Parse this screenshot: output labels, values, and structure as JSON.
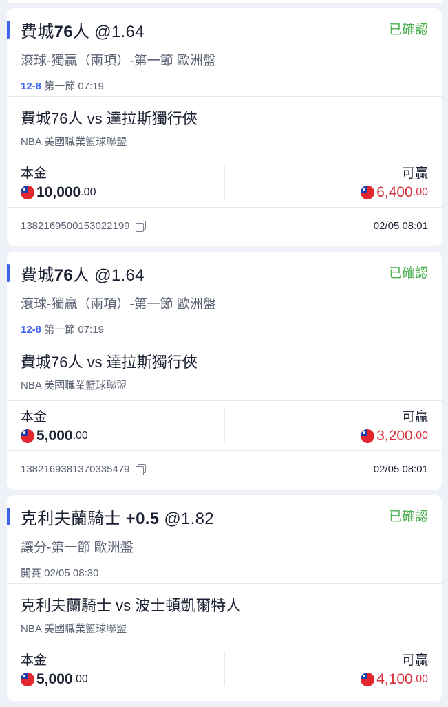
{
  "bets": [
    {
      "title_team": "費城",
      "title_num": "76",
      "title_suffix": "人",
      "title_line": "",
      "title_odds": "@1.64",
      "status": "已確認",
      "market": "滾球-獨贏（兩項）-第一節 歐洲盤",
      "period_prefix": "12-8",
      "period_text": "第一節 07:19",
      "teams": "費城76人 vs 達拉斯獨行俠",
      "league": "NBA 美國職業籃球聯盟",
      "stake_label": "本金",
      "stake_big": "10,000",
      "stake_small": ".00",
      "win_label": "可贏",
      "win_big": "6,400",
      "win_small": ".00",
      "ticket_id": "1382169500153022199",
      "time": "02/05 08:01"
    },
    {
      "title_team": "費城",
      "title_num": "76",
      "title_suffix": "人",
      "title_line": "",
      "title_odds": "@1.64",
      "status": "已確認",
      "market": "滾球-獨贏（兩項）-第一節 歐洲盤",
      "period_prefix": "12-8",
      "period_text": "第一節 07:19",
      "teams": "費城76人 vs 達拉斯獨行俠",
      "league": "NBA 美國職業籃球聯盟",
      "stake_label": "本金",
      "stake_big": "5,000",
      "stake_small": ".00",
      "win_label": "可贏",
      "win_big": "3,200",
      "win_small": ".00",
      "ticket_id": "1382169381370335479",
      "time": "02/05 08:01"
    },
    {
      "title_team": "克利夫蘭騎士",
      "title_num": "",
      "title_suffix": "",
      "title_line": "+0.5",
      "title_odds": "@1.82",
      "status": "已確認",
      "market": "讓分-第一節 歐洲盤",
      "period_prefix": "",
      "period_text": "開賽 02/05 08:30",
      "teams": "克利夫蘭騎士 vs 波士頓凱爾特人",
      "league": "NBA 美國職業籃球聯盟",
      "stake_label": "本金",
      "stake_big": "5,000",
      "stake_small": ".00",
      "win_label": "可贏",
      "win_big": "4,100",
      "win_small": ".00"
    }
  ],
  "colors": {
    "accent": "#3d63f0",
    "confirmed": "#4caf50",
    "win": "#d8323c"
  },
  "icons": {
    "currency": "taiwan-flag-icon",
    "copy": "copy-icon"
  }
}
